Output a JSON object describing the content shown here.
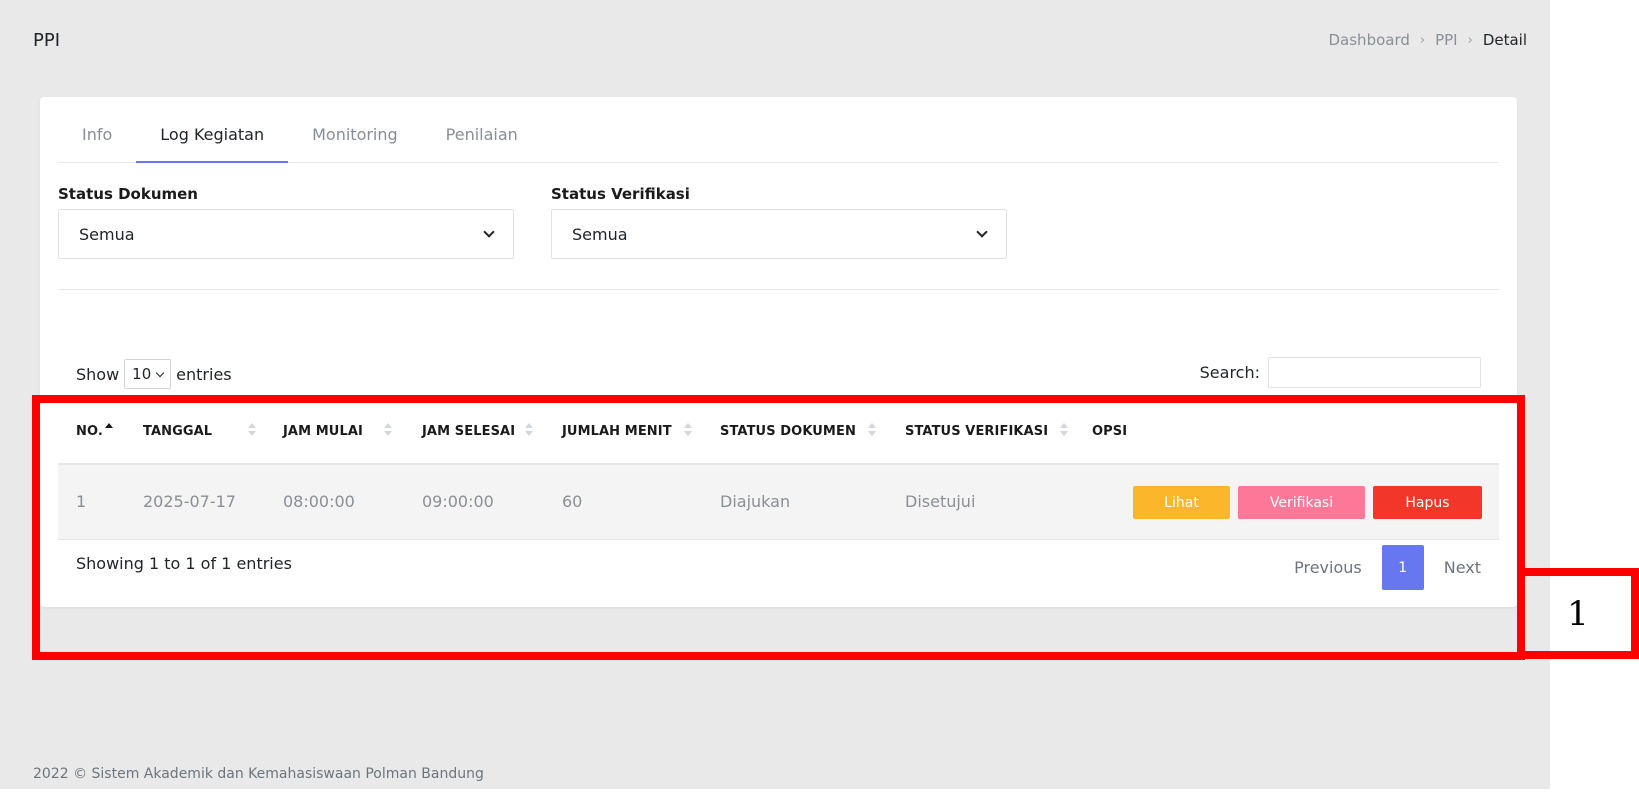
{
  "header": {
    "title": "PPI",
    "breadcrumb": [
      "Dashboard",
      "PPI",
      "Detail"
    ]
  },
  "tabs": [
    "Info",
    "Log Kegiatan",
    "Monitoring",
    "Penilaian"
  ],
  "active_tab": "Log Kegiatan",
  "filters": {
    "status_dokumen": {
      "label": "Status Dokumen",
      "value": "Semua"
    },
    "status_verifikasi": {
      "label": "Status Verifikasi",
      "value": "Semua"
    }
  },
  "table_controls": {
    "show": "Show",
    "length": "10",
    "entries": "entries",
    "search_label": "Search:",
    "search_value": ""
  },
  "table": {
    "headers": [
      "NO.",
      "TANGGAL",
      "JAM MULAI",
      "JAM SELESAI",
      "JUMLAH MENIT",
      "STATUS DOKUMEN",
      "STATUS VERIFIKASI",
      "OPSI"
    ],
    "rows": [
      {
        "no": "1",
        "tanggal": "2025-07-17",
        "jam_mulai": "08:00:00",
        "jam_selesai": "09:00:00",
        "jumlah_menit": "60",
        "status_dokumen": "Diajukan",
        "status_verifikasi": "Disetujui"
      }
    ],
    "actions": {
      "lihat": "Lihat",
      "verifikasi": "Verifikasi",
      "hapus": "Hapus"
    }
  },
  "pagination": {
    "info": "Showing 1 to 1 of 1 entries",
    "previous": "Previous",
    "current": "1",
    "next": "Next"
  },
  "annotation_label": "1",
  "footer": "2022 © Sistem Akademik dan Kemahasiswaan Polman Bandung",
  "colors": {
    "primary": "#6777ef",
    "warning": "#fbb62b",
    "pink": "#fd7898",
    "danger": "#f3362a",
    "highlight": "#ff0000"
  }
}
